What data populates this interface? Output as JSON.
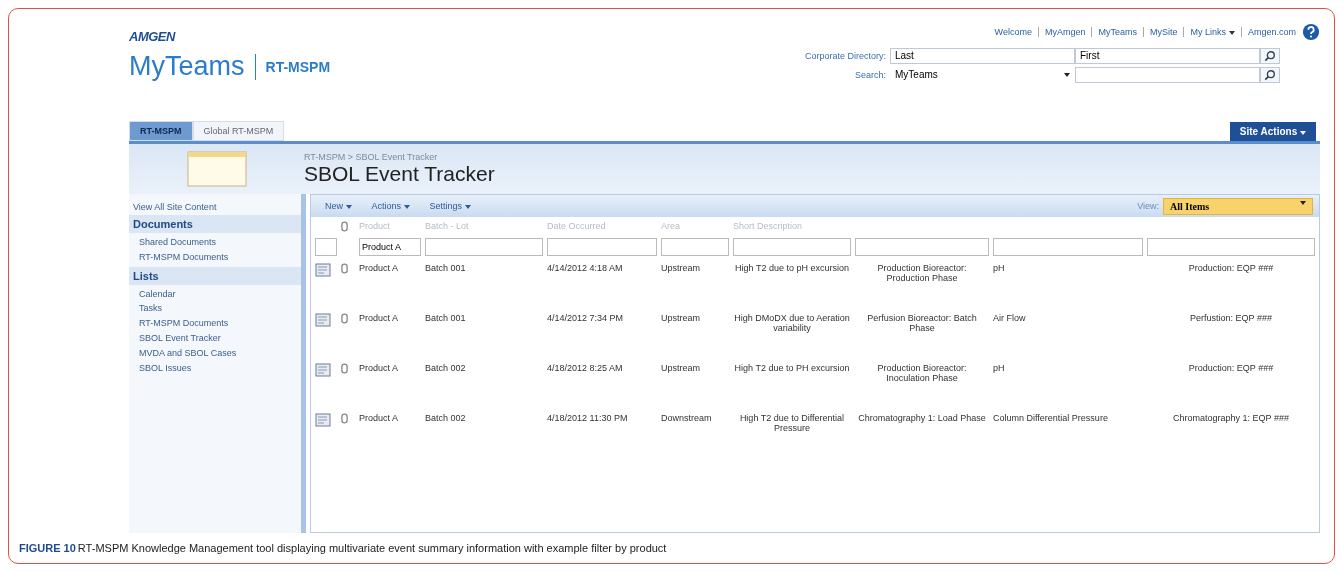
{
  "header": {
    "logo": "AMGEN",
    "site_title": "MyTeams",
    "site_name": "RT-MSPM",
    "top_links": [
      {
        "label": "Welcome",
        "dropdown": false
      },
      {
        "label": "MyAmgen",
        "dropdown": false
      },
      {
        "label": "MyTeams",
        "dropdown": false
      },
      {
        "label": "MySite",
        "dropdown": false
      },
      {
        "label": "My Links",
        "dropdown": true
      },
      {
        "label": "Amgen.com",
        "dropdown": false
      }
    ],
    "directory": {
      "label": "Corporate Directory:",
      "last": "Last",
      "first": "First"
    },
    "search": {
      "label": "Search:",
      "scope": "MyTeams"
    }
  },
  "tabs": [
    {
      "label": "RT-MSPM",
      "selected": true
    },
    {
      "label": "Global RT-MSPM",
      "selected": false
    }
  ],
  "site_actions": "Site Actions",
  "breadcrumb": "RT-MSPM > SBOL Event Tracker",
  "page_title": "SBOL Event Tracker",
  "sidebar": {
    "top_link": "View All Site Content",
    "sections": [
      {
        "heading": "Documents",
        "items": [
          "Shared Documents",
          "RT-MSPM Documents"
        ]
      },
      {
        "heading": "Lists",
        "items": [
          "Calendar",
          "Tasks",
          "RT-MSPM Documents",
          "SBOL Event Tracker",
          "MVDA and SBOL Cases",
          "SBOL Issues"
        ]
      }
    ]
  },
  "toolbar": {
    "menus": [
      "New",
      "Actions",
      "Settings"
    ],
    "view_label": "View:",
    "view": "All Items"
  },
  "table": {
    "columns": [
      {
        "label": "Product",
        "filter_value": "Product A"
      },
      {
        "label": "Batch - Lot"
      },
      {
        "label": "Date Occurred"
      },
      {
        "label": "Area"
      },
      {
        "label": "Short Description"
      },
      {},
      {},
      {}
    ],
    "rows": [
      {
        "cells": [
          "Product A",
          "Batch 001",
          "4/14/2012 4:18 AM",
          "Upstream",
          "High T2 due to pH excursion",
          "Production Bioreactor: Production Phase",
          "pH",
          "Production: EQP ###"
        ]
      },
      {
        "cells": [
          "Product A",
          "Batch 001",
          "4/14/2012 7:34 PM",
          "Upstream",
          "High DMoDX due to Aeration variability",
          "Perfusion Bioreactor: Batch Phase",
          "Air Flow",
          "Perfustion: EQP ###"
        ]
      },
      {
        "cells": [
          "Product A",
          "Batch 002",
          "4/18/2012 8:25 AM",
          "Upstream",
          "High T2 due to PH excursion",
          "Production Bioreactor: Inoculation Phase",
          "pH",
          "Production: EQP ###"
        ]
      },
      {
        "cells": [
          "Product A",
          "Batch 002",
          "4/18/2012 11:30 PM",
          "Downstream",
          "High T2 due to Differential Pressure",
          "Chromatography 1: Load Phase",
          "Column Differential Pressure",
          "Chromatography 1: EQP ###"
        ]
      }
    ]
  },
  "caption": {
    "label": "FIGURE 10",
    "text": "RT-MSPM Knowledge Management tool displaying multivariate event summary information with example filter by product"
  }
}
